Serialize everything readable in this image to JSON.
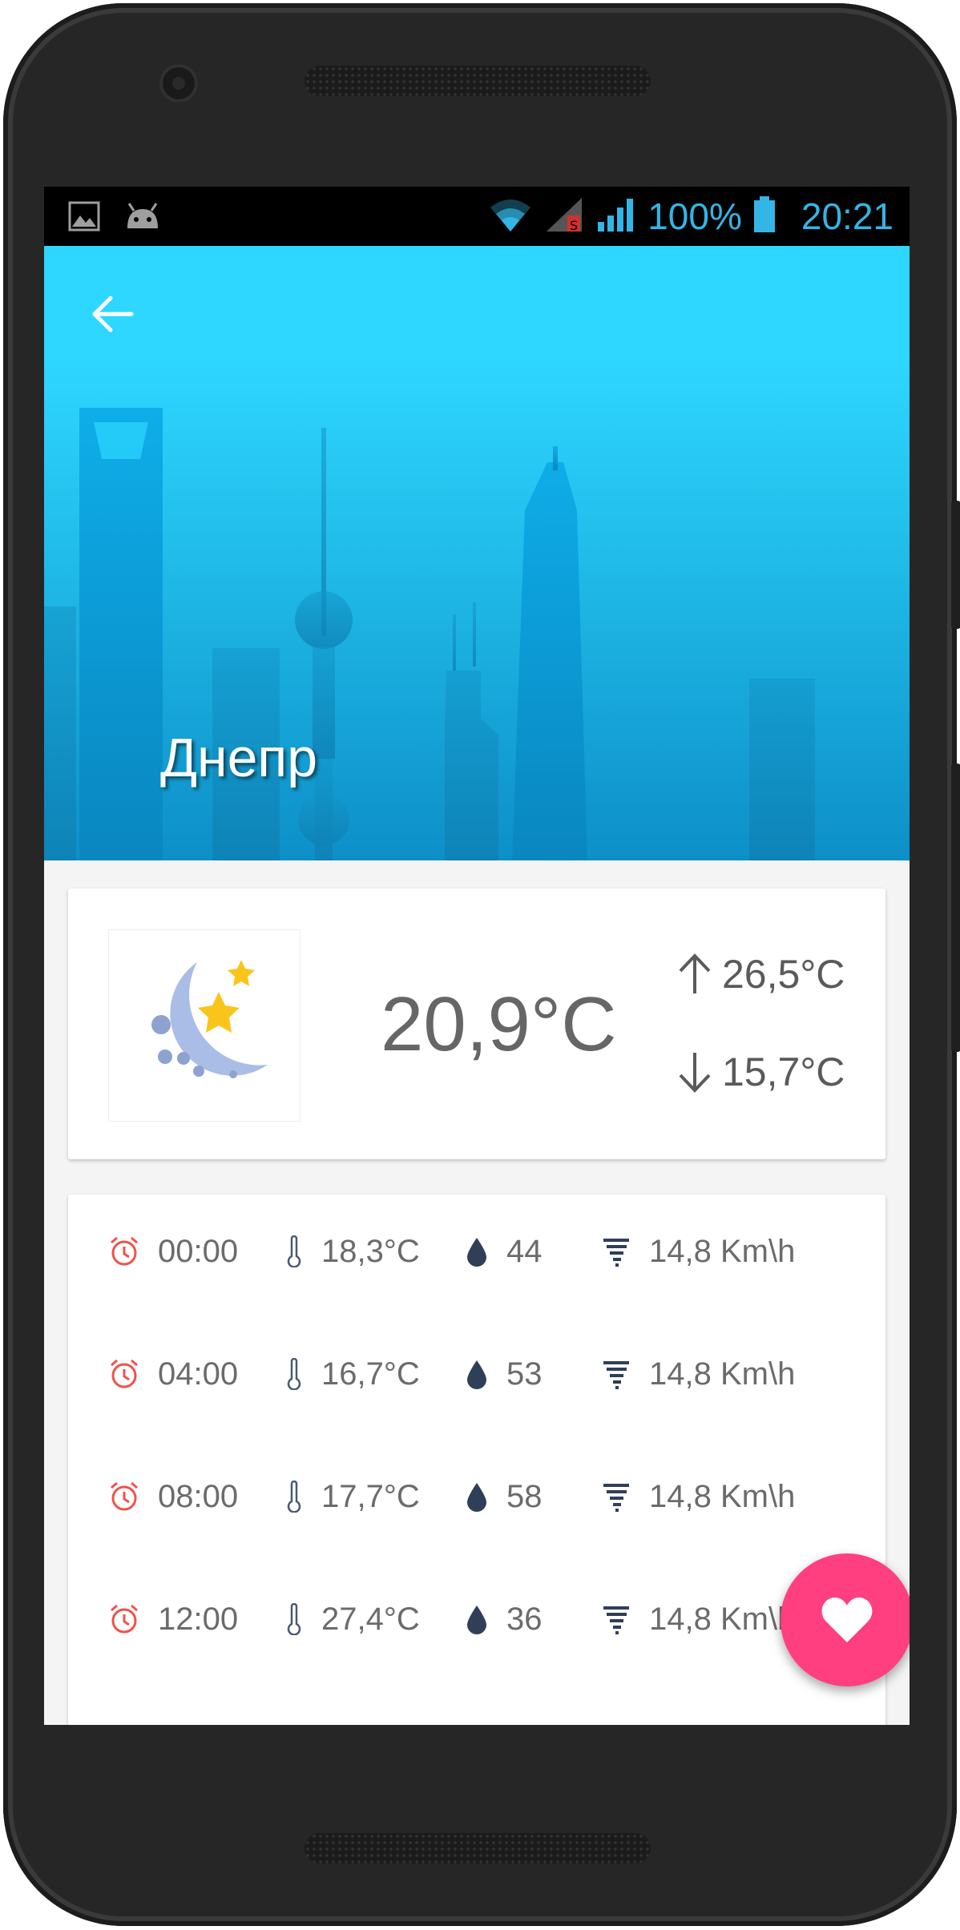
{
  "status_bar": {
    "battery_percent": "100%",
    "time": "20:21",
    "notification_icons": [
      "image-icon",
      "android-icon"
    ],
    "system_icons": [
      "wifi-icon",
      "signal-sim1-icon",
      "signal-sim2-icon",
      "battery-icon"
    ]
  },
  "header": {
    "city": "Днепр",
    "back_icon": "arrow-left-icon"
  },
  "current": {
    "icon": "crescent-moon-stars-icon",
    "temperature": "20,9°C",
    "max_temperature": "26,5°C",
    "min_temperature": "15,7°C"
  },
  "forecast": [
    {
      "time": "00:00",
      "temperature": "18,3°C",
      "humidity": "44",
      "wind": "14,8 Km\\h"
    },
    {
      "time": "04:00",
      "temperature": "16,7°C",
      "humidity": "53",
      "wind": "14,8 Km\\h"
    },
    {
      "time": "08:00",
      "temperature": "17,7°C",
      "humidity": "58",
      "wind": "14,8 Km\\h"
    },
    {
      "time": "12:00",
      "temperature": "27,4°C",
      "humidity": "36",
      "wind": "14,8 Km\\h"
    }
  ],
  "fab": {
    "icon": "heart-icon"
  },
  "colors": {
    "sky_top": "#2ed7ff",
    "sky_bottom": "#0d8fc8",
    "alarm_icon": "#f0524a",
    "drop_icon": "#2f3f58",
    "fab": "#ff3f80",
    "moon": "#a9bde6",
    "star": "#f9c51b",
    "status_text": "#33b5e5"
  }
}
